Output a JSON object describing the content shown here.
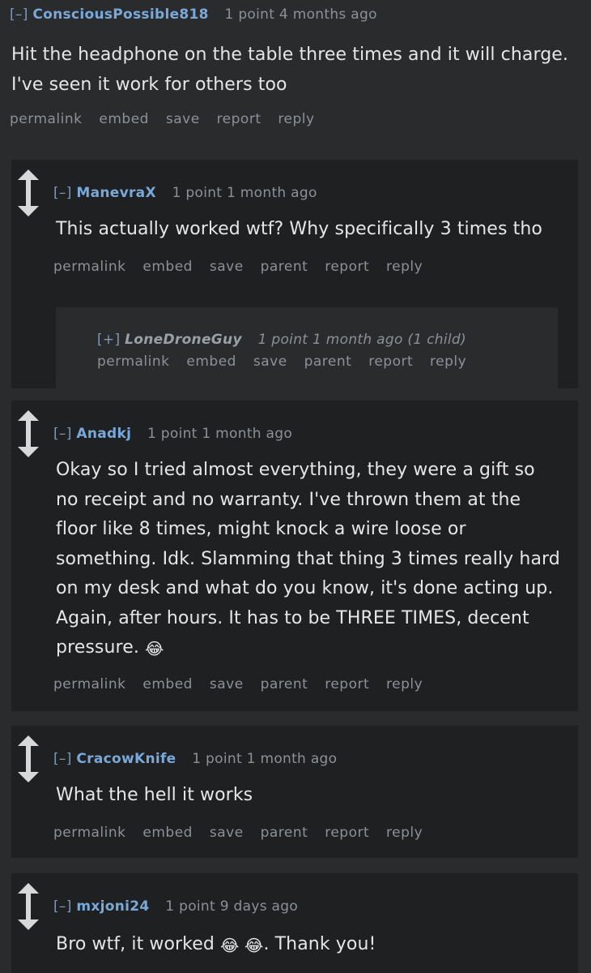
{
  "comments": [
    {
      "collapse": "[–]",
      "author": "ConsciousPossible818",
      "score": "1 point",
      "time": "4 months ago",
      "body": [
        "Hit the headphone on the table three times and it will charge.",
        "I've seen it work for others too"
      ],
      "actions": [
        "permalink",
        "embed",
        "save",
        "report",
        "reply"
      ]
    },
    {
      "collapse": "[–]",
      "author": "ManevraX",
      "score": "1 point",
      "time": "1 month ago",
      "body": [
        "This actually worked wtf? Why specifically 3 times tho"
      ],
      "actions": [
        "permalink",
        "embed",
        "save",
        "parent",
        "report",
        "reply"
      ]
    },
    {
      "collapse": "[+]",
      "author": "LoneDroneGuy",
      "score": "1 point",
      "time": "1 month ago (1 child)",
      "actions": [
        "permalink",
        "embed",
        "save",
        "parent",
        "report",
        "reply"
      ]
    },
    {
      "collapse": "[–]",
      "author": "Anadkj",
      "score": "1 point",
      "time": "1 month ago",
      "body": [
        "Okay so I tried almost everything, they were a gift so",
        "no receipt and no warranty. I've thrown them at the",
        "floor like 8 times, might knock a wire loose or",
        "something. Idk. Slamming that thing 3 times really hard",
        "on my desk and what do you know, it's done acting up.",
        "Again, after hours. It has to be THREE TIMES, decent",
        "pressure."
      ],
      "emoji": "😂",
      "actions": [
        "permalink",
        "embed",
        "save",
        "parent",
        "report",
        "reply"
      ]
    },
    {
      "collapse": "[–]",
      "author": "CracowKnife",
      "score": "1 point",
      "time": "1 month ago",
      "body": [
        "What the hell it works"
      ],
      "actions": [
        "permalink",
        "embed",
        "save",
        "parent",
        "report",
        "reply"
      ]
    },
    {
      "collapse": "[–]",
      "author": "mxjoni24",
      "score": "1 point",
      "time": "9 days ago",
      "body_pre": "Bro wtf, it worked",
      "emojis": "😂 😂",
      "body_post": ". Thank you!"
    }
  ],
  "icons": {
    "vote": "vote-arrows-icon"
  },
  "colors": {
    "author": "#79a9da",
    "background": "#2a2b2d",
    "box": "#1f2022"
  }
}
